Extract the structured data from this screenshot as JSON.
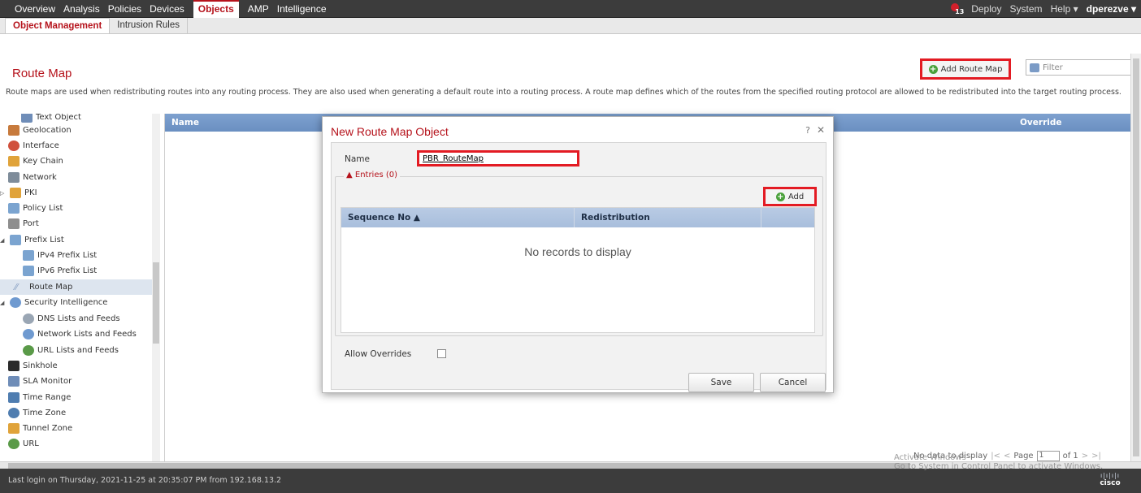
{
  "top_nav": {
    "items": [
      "Overview",
      "Analysis",
      "Policies",
      "Devices",
      "Objects",
      "AMP",
      "Intelligence"
    ],
    "active": "Objects",
    "right": {
      "notification_count": "13",
      "deploy": "Deploy",
      "system": "System",
      "help": "Help ▾",
      "user": "dperezve ▾"
    }
  },
  "sub_nav": {
    "tabs": [
      "Object Management",
      "Intrusion Rules"
    ],
    "active": "Object Management"
  },
  "page": {
    "title": "Route Map",
    "description": "Route maps are used when redistributing routes into any routing process. They are also used when generating a default route into a routing process. A route map defines which of the routes from the specified routing protocol are allowed to be redistributed into the target routing process.",
    "add_button": "Add Route Map",
    "filter_placeholder": "Filter"
  },
  "sidebar": {
    "items": [
      {
        "label": "Text Object",
        "icon": "text-object-icon",
        "color": "#6f8db8"
      },
      {
        "label": "Geolocation",
        "icon": "geolocation-icon",
        "color": "#c77a3c"
      },
      {
        "label": "Interface",
        "icon": "interface-icon",
        "color": "#d0503c"
      },
      {
        "label": "Key Chain",
        "icon": "key-chain-icon",
        "color": "#e0a33a"
      },
      {
        "label": "Network",
        "icon": "network-icon",
        "color": "#7e8c9a"
      },
      {
        "label": "PKI",
        "icon": "pki-icon",
        "color": "#e0a33a"
      },
      {
        "label": "Policy List",
        "icon": "policy-list-icon",
        "color": "#7ba4d0"
      },
      {
        "label": "Port",
        "icon": "port-icon",
        "color": "#8e8e8e"
      },
      {
        "label": "Prefix List",
        "icon": "prefix-list-icon",
        "color": "#7ba4d0"
      },
      {
        "label": "IPv4 Prefix List",
        "icon": "ipv4-prefix-list-icon",
        "color": "#7ba4d0"
      },
      {
        "label": "IPv6 Prefix List",
        "icon": "ipv6-prefix-list-icon",
        "color": "#7ba4d0"
      },
      {
        "label": "Route Map",
        "icon": "route-map-icon",
        "color": "#8aa2c4"
      },
      {
        "label": "Security Intelligence",
        "icon": "security-intelligence-icon",
        "color": "#6f9ad0"
      },
      {
        "label": "DNS Lists and Feeds",
        "icon": "dns-lists-icon",
        "color": "#9aa6b4"
      },
      {
        "label": "Network Lists and Feeds",
        "icon": "network-lists-icon",
        "color": "#6f9ad0"
      },
      {
        "label": "URL Lists and Feeds",
        "icon": "url-lists-icon",
        "color": "#5a9a48"
      },
      {
        "label": "Sinkhole",
        "icon": "sinkhole-icon",
        "color": "#2b2b2b"
      },
      {
        "label": "SLA Monitor",
        "icon": "sla-monitor-icon",
        "color": "#6f8db8"
      },
      {
        "label": "Time Range",
        "icon": "time-range-icon",
        "color": "#4f7db0"
      },
      {
        "label": "Time Zone",
        "icon": "time-zone-icon",
        "color": "#4f7db0"
      },
      {
        "label": "Tunnel Zone",
        "icon": "tunnel-zone-icon",
        "color": "#e0a33a"
      },
      {
        "label": "URL",
        "icon": "url-icon",
        "color": "#5a9a48"
      }
    ],
    "selected": "Route Map"
  },
  "table": {
    "columns": [
      "Name",
      "Override"
    ]
  },
  "dialog": {
    "title": "New Route Map Object",
    "help": "?",
    "close": "✕",
    "name_label": "Name",
    "name_value": "PBR_RouteMap",
    "entries_label": "▲ Entries (0)",
    "add_button": "Add",
    "entries_columns": [
      "Sequence No ▲",
      "Redistribution"
    ],
    "empty_message": "No records to display",
    "allow_overrides_label": "Allow Overrides",
    "save_button": "Save",
    "cancel_button": "Cancel"
  },
  "pager": {
    "status": "No data to display",
    "page_label": "Page",
    "page_value": "1",
    "of_label": "of 1"
  },
  "footer": {
    "login_text": "Last login on Thursday, 2021-11-25 at 20:35:07 PM from 192.168.13.2",
    "watermark_line1": "Activate Windows",
    "watermark_line2": "Go to System in Control Panel to activate Windows.",
    "logo_text": "cisco"
  }
}
